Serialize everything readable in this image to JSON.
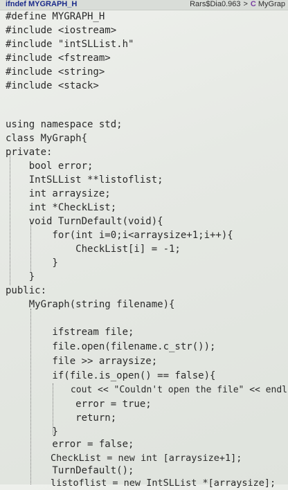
{
  "tab_bar": {
    "left_fragment": "ifndef MYGRAPH_H",
    "path_fragment": "Rars$Dia0.963",
    "separator": ">",
    "class_icon": "C",
    "class_name": "MyGrap"
  },
  "code": {
    "lines": [
      "#define MYGRAPH_H",
      "#include <iostream>",
      "#include \"intSLList.h\"",
      "#include <fstream>",
      "#include <string>",
      "#include <stack>",
      "",
      "using namespace std;",
      "class MyGraph{",
      "private:",
      "    bool error;",
      "    IntSLList **listoflist;",
      "    int arraysize;",
      "    int *CheckList;",
      "    void TurnDefault(void){",
      "        for(int i=0;i<arraysize+1;i++){",
      "            CheckList[i] = -1;",
      "        }",
      "    }",
      "public:",
      "    MyGraph(string filename){",
      "",
      "        ifstream file;",
      "        file.open(filename.c_str());",
      "        file >> arraysize;",
      "        if(file.is_open() == false){",
      "            cout << \"Couldn't open the file\" << endl;",
      "            error = true;",
      "            return;",
      "        }",
      "        error = false;",
      "        CheckList = new int [arraysize+1];",
      "        TurnDefault();",
      "        listoflist = new IntSLList *[arraysize];"
    ]
  }
}
